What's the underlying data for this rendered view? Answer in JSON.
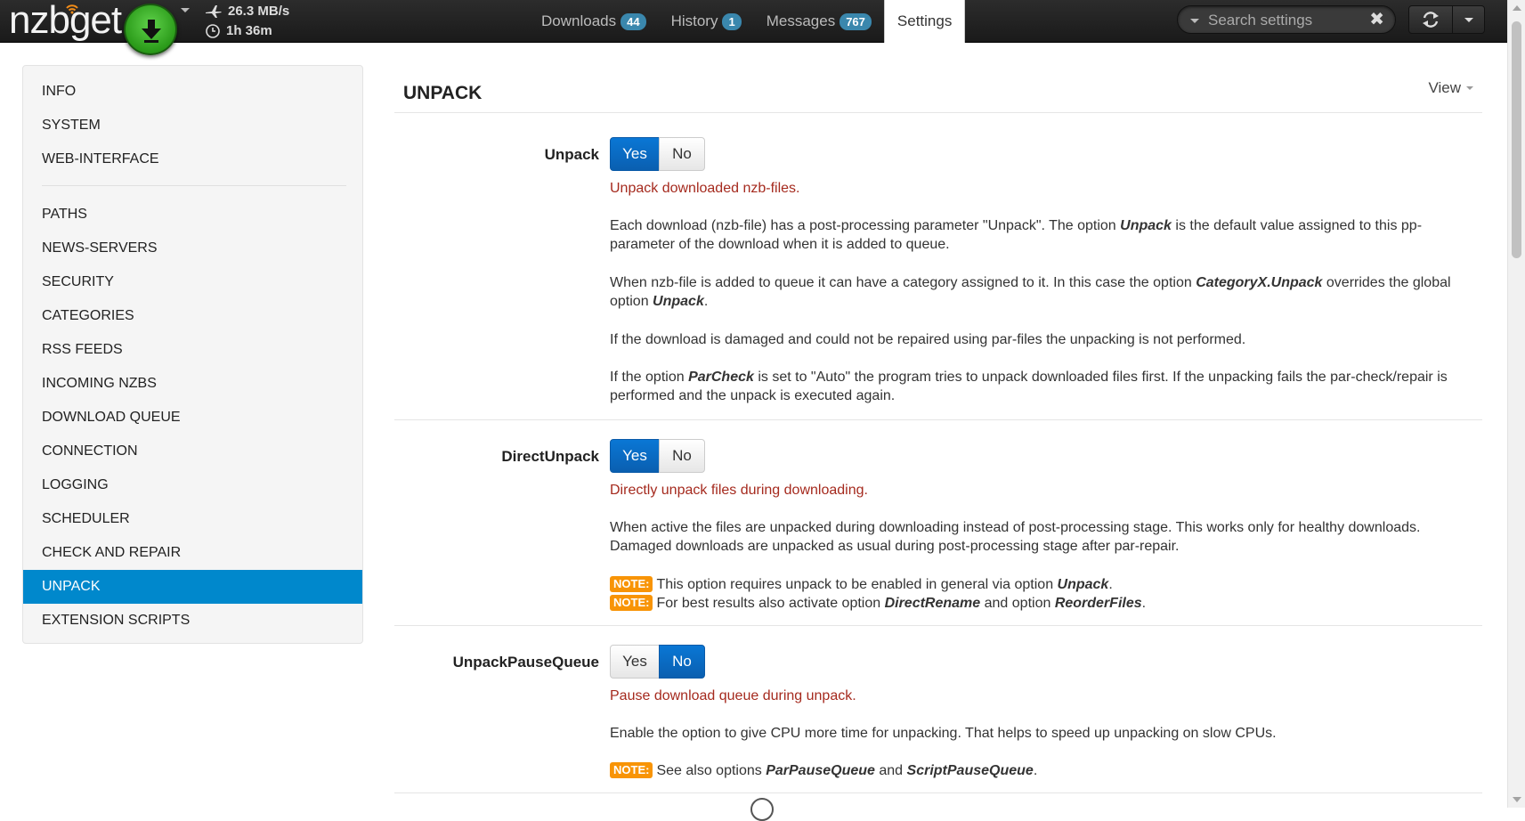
{
  "navbar": {
    "brand": "nzbget",
    "speed": "26.3 MB/s",
    "time_left": "1h 36m",
    "tabs": [
      {
        "label": "Downloads",
        "badge": "44"
      },
      {
        "label": "History",
        "badge": "1"
      },
      {
        "label": "Messages",
        "badge": "767"
      },
      {
        "label": "Settings",
        "badge": ""
      }
    ],
    "search_placeholder": "Search settings",
    "icons": {
      "play": "download-arrow-icon",
      "refresh": "refresh-icon",
      "speed": "plane-icon",
      "time": "clock-icon",
      "clear": "close-icon"
    }
  },
  "sidebar": {
    "items": [
      "INFO",
      "SYSTEM",
      "WEB-INTERFACE",
      "PATHS",
      "NEWS-SERVERS",
      "SECURITY",
      "CATEGORIES",
      "RSS FEEDS",
      "INCOMING NZBS",
      "DOWNLOAD QUEUE",
      "CONNECTION",
      "LOGGING",
      "SCHEDULER",
      "CHECK AND REPAIR",
      "UNPACK",
      "EXTENSION SCRIPTS"
    ],
    "active": "UNPACK"
  },
  "main": {
    "title": "UNPACK",
    "view_label": "View",
    "yes_label": "Yes",
    "no_label": "No",
    "note_label": "NOTE:",
    "options": {
      "unpack": {
        "name": "Unpack",
        "value": "Yes",
        "summary": "Unpack downloaded nzb-files.",
        "p1_a": "Each download (nzb-file) has a post-processing parameter \"Unpack\". The option ",
        "p1_b": "Unpack",
        "p1_c": " is the default value assigned to this pp-parameter of the download when it is added to queue.",
        "p2_a": "When nzb-file is added to queue it can have a category assigned to it. In this case the option ",
        "p2_b": "CategoryX.Unpack",
        "p2_c": " overrides the global option ",
        "p2_d": "Unpack",
        "p2_e": ".",
        "p3": "If the download is damaged and could not be repaired using par-files the unpacking is not performed.",
        "p4_a": "If the option ",
        "p4_b": "ParCheck",
        "p4_c": " is set to \"Auto\" the program tries to unpack downloaded files first. If the unpacking fails the par-check/repair is performed and the unpack is executed again."
      },
      "direct_unpack": {
        "name": "DirectUnpack",
        "value": "Yes",
        "summary": "Directly unpack files during downloading.",
        "p1": "When active the files are unpacked during downloading instead of post-processing stage. This works only for healthy downloads. Damaged downloads are unpacked as usual during post-processing stage after par-repair.",
        "n1_a": "This option requires unpack to be enabled in general via option ",
        "n1_b": "Unpack",
        "n1_c": ".",
        "n2_a": "For best results also activate option ",
        "n2_b": "DirectRename",
        "n2_c": " and option ",
        "n2_d": "ReorderFiles",
        "n2_e": "."
      },
      "unpack_pause_queue": {
        "name": "UnpackPauseQueue",
        "value": "No",
        "summary": "Pause download queue during unpack.",
        "p1": "Enable the option to give CPU more time for unpacking. That helps to speed up unpacking on slow CPUs.",
        "n1_a": "See also options ",
        "n1_b": "ParPauseQueue",
        "n1_c": " and ",
        "n1_d": "ScriptPauseQueue",
        "n1_e": "."
      }
    }
  },
  "colors": {
    "accent": "#0088cc",
    "toggle_on": "#0a6bc4",
    "summary": "#a52a1e",
    "note": "#f89406",
    "badge": "#3a87ad"
  }
}
